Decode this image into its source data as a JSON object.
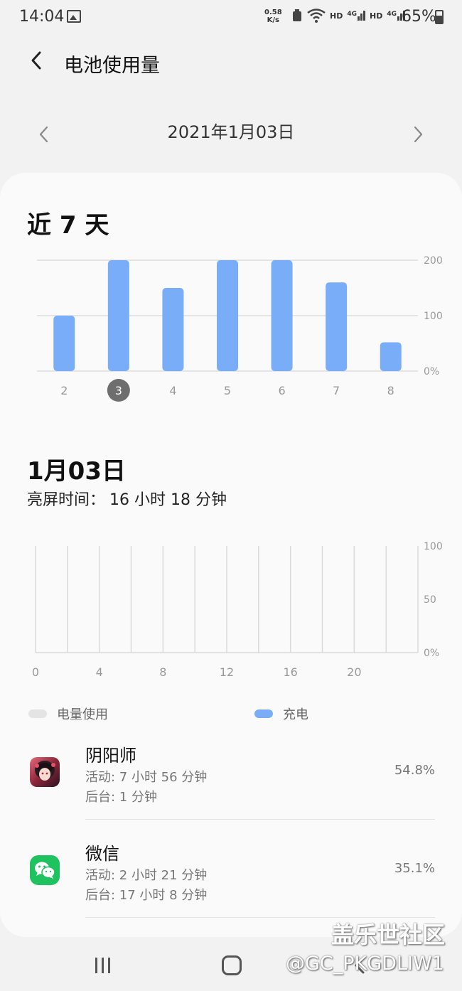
{
  "status_bar": {
    "time": "14:04",
    "net_speed_value": "0.58",
    "net_speed_unit": "K/s",
    "hd1": "HD",
    "sig1": "4G",
    "hd2": "HD",
    "sig2": "4G",
    "battery": "65%"
  },
  "header": {
    "title": "电池使用量"
  },
  "date_nav": {
    "label": "2021年1月03日"
  },
  "weekly": {
    "title": "近 7 天",
    "chart_data": {
      "type": "bar",
      "categories": [
        "2",
        "3",
        "4",
        "5",
        "6",
        "7",
        "8"
      ],
      "values": [
        100,
        200,
        150,
        200,
        200,
        160,
        52
      ],
      "ylim": [
        0,
        200
      ],
      "y_ticks": [
        "0%",
        "100",
        "200"
      ],
      "selected": "3",
      "bar_color": "#7aadf8",
      "grid": true
    }
  },
  "day": {
    "title": "1月03日",
    "screen_time_label": "亮屏时间：",
    "screen_time_value": "16 小时 18 分钟",
    "chart_data": {
      "type": "area",
      "x_ticks": [
        "0",
        "4",
        "8",
        "12",
        "16",
        "20"
      ],
      "xlim": [
        0,
        24
      ],
      "ylim": [
        0,
        100
      ],
      "y_ticks": [
        "0%",
        "50",
        "100"
      ],
      "grid": true
    }
  },
  "legend": {
    "usage": {
      "label": "电量使用",
      "color": "#e4e4e4"
    },
    "charge": {
      "label": "充电",
      "color": "#7aadf8"
    }
  },
  "apps": [
    {
      "name": "阴阳师",
      "active": "活动: 7 小时 56 分钟",
      "background": "后台: 1 分钟",
      "percent": "54.8%",
      "icon": "onmyoji-app-icon"
    },
    {
      "name": "微信",
      "active": "活动: 2 小时 21 分钟",
      "background": "后台: 17 小时 8 分钟",
      "percent": "35.1%",
      "icon": "wechat-app-icon"
    }
  ],
  "watermark": {
    "line1": "盖乐世社区",
    "line2": "@GC_PKGDLIW1"
  }
}
